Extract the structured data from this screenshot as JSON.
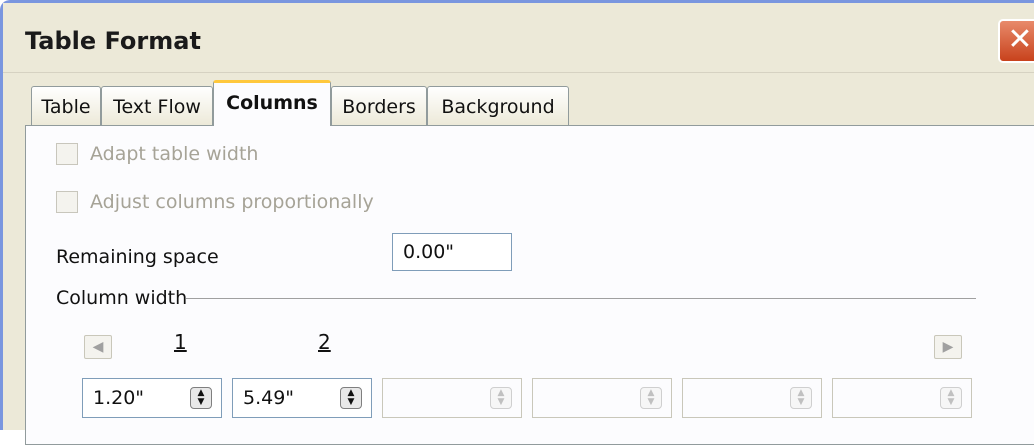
{
  "window": {
    "title": "Table Format",
    "close_glyph": "✕"
  },
  "tabs": [
    {
      "label": "Table",
      "active": false
    },
    {
      "label": "Text Flow",
      "active": false
    },
    {
      "label": "Columns",
      "active": true
    },
    {
      "label": "Borders",
      "active": false
    },
    {
      "label": "Background",
      "active": false
    }
  ],
  "options": {
    "adapt_table_width": {
      "label": "Adapt table width",
      "checked": false,
      "enabled": false
    },
    "adjust_columns": {
      "label": "Adjust columns proportionally",
      "checked": false,
      "enabled": false
    }
  },
  "remaining_space": {
    "label": "Remaining space",
    "value": "0.00\""
  },
  "column_width": {
    "heading": "Column width",
    "left_arrow": "◀",
    "right_arrow": "▶",
    "columns": [
      {
        "number": "1",
        "value": "1.20\""
      },
      {
        "number": "2",
        "value": "5.49\""
      },
      {
        "number": "",
        "value": ""
      },
      {
        "number": "",
        "value": ""
      },
      {
        "number": "",
        "value": ""
      },
      {
        "number": "",
        "value": ""
      }
    ]
  },
  "colors": {
    "accent": "#ffc83c",
    "window_bg": "#ece9d8",
    "titlebar_border": "#7a96df",
    "close_bg": "#c8421c"
  },
  "icons": {
    "close": "close-icon",
    "spin": "spin-updown-icon",
    "left": "arrow-left-icon",
    "right": "arrow-right-icon"
  }
}
